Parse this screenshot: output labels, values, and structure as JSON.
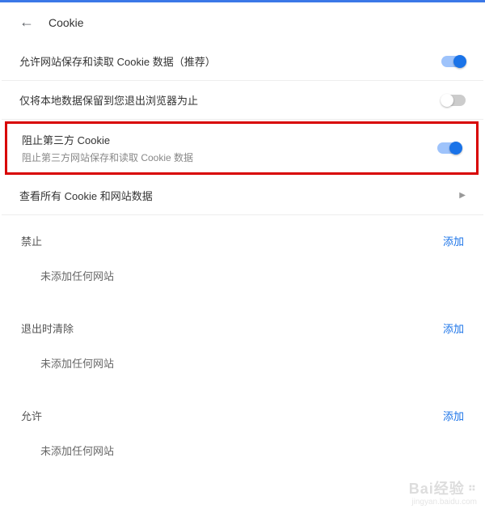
{
  "header": {
    "title": "Cookie"
  },
  "rows": {
    "allow_save": {
      "label": "允许网站保存和读取 Cookie 数据（推荐）",
      "on": true
    },
    "session_only": {
      "label": "仅将本地数据保留到您退出浏览器为止",
      "on": false
    },
    "block_third": {
      "title": "阻止第三方 Cookie",
      "sub": "阻止第三方网站保存和读取 Cookie 数据",
      "on": true
    },
    "view_all": {
      "label": "查看所有 Cookie 和网站数据"
    }
  },
  "sections": {
    "block": {
      "label": "禁止",
      "add": "添加",
      "empty": "未添加任何网站"
    },
    "clear": {
      "label": "退出时清除",
      "add": "添加",
      "empty": "未添加任何网站"
    },
    "allow": {
      "label": "允许",
      "add": "添加",
      "empty": "未添加任何网站"
    }
  },
  "watermark": {
    "brand": "Bai",
    "brand2": "经验",
    "url": "jingyan.baidu.com"
  }
}
